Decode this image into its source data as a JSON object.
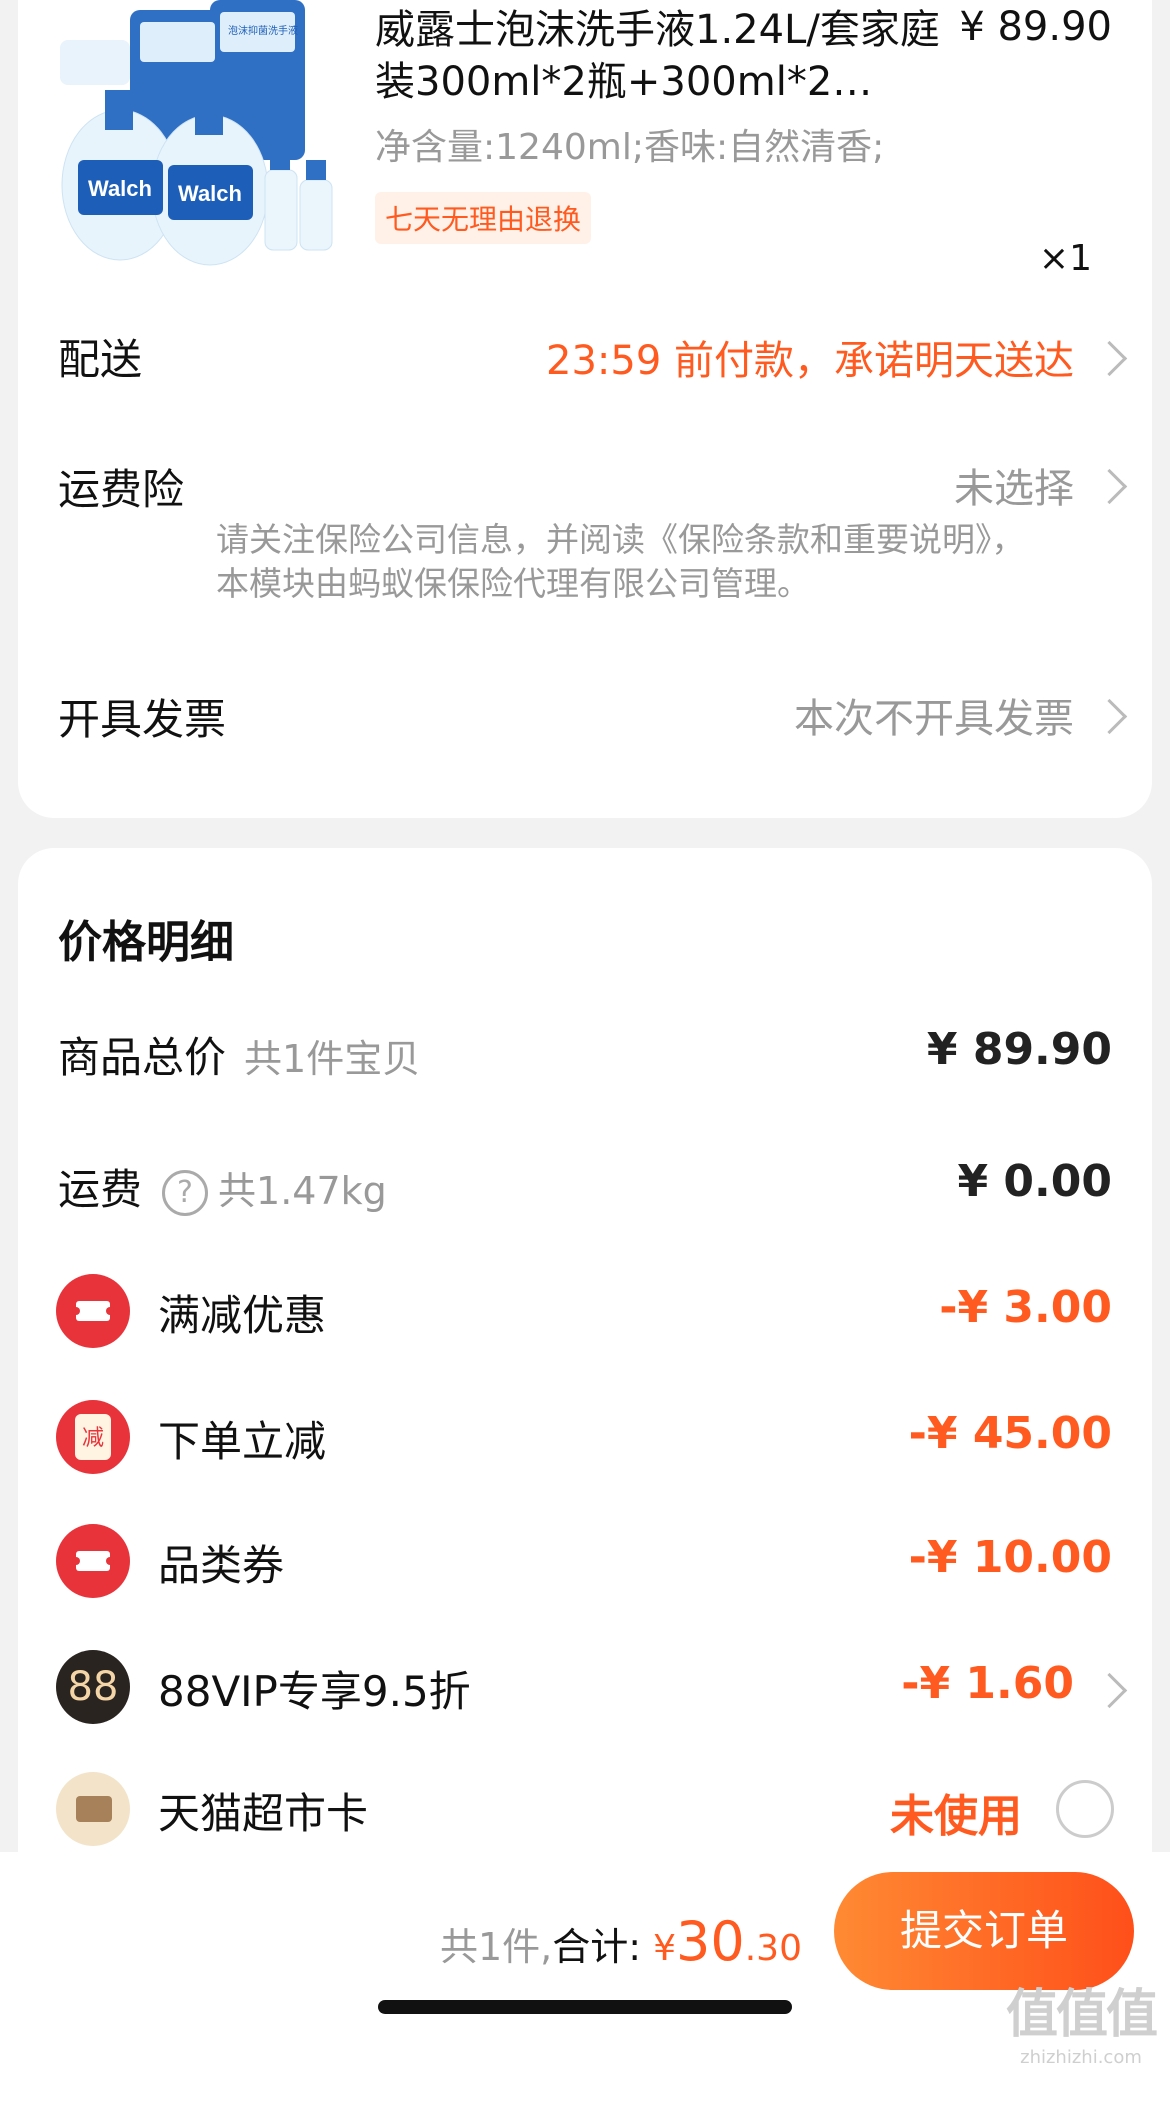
{
  "product": {
    "title": "威露士泡沫洗手液1.24L/套家庭装300ml*2瓶+300ml*2…",
    "price": "¥ 89.90",
    "spec": "净含量:1240ml;香味:自然清香;",
    "tag": "七天无理由退换",
    "qty": "×1",
    "brand_text": "Walch",
    "pack_text": "泡沫抑菌洗手液"
  },
  "delivery": {
    "label": "配送",
    "value": "23:59 前付款，承诺明天送达"
  },
  "insurance": {
    "label": "运费险",
    "value": "未选择",
    "note": "请关注保险公司信息，并阅读《保险条款和重要说明》，本模块由蚂蚁保保险代理有限公司管理。"
  },
  "invoice": {
    "label": "开具发票",
    "value": "本次不开具发票"
  },
  "price_detail": {
    "title": "价格明细",
    "goods_total": {
      "label": "商品总价",
      "sub": "共1件宝贝",
      "value": "¥ 89.90"
    },
    "shipping": {
      "label": "运费",
      "sub": "共1.47kg",
      "value": "¥ 0.00"
    },
    "discounts": [
      {
        "label": "满减优惠",
        "value": "-¥ 3.00",
        "icon": "ticket-icon"
      },
      {
        "label": "下单立减",
        "value": "-¥ 45.00",
        "icon": "redbag-icon",
        "icon_text": "减"
      },
      {
        "label": "品类券",
        "value": "-¥ 10.00",
        "icon": "ticket-icon"
      },
      {
        "label": "88VIP专享9.5折",
        "value": "-¥ 1.60",
        "icon": "vip-icon",
        "icon_text": "88"
      }
    ],
    "supermarket_card": {
      "label": "天猫超市卡",
      "value": "未使用"
    }
  },
  "footer": {
    "count": "共1件,",
    "total_label": "合计:",
    "currency": "¥",
    "total_int": "30",
    "total_dec": ".30",
    "submit": "提交订单"
  },
  "watermark": {
    "big": "值值值",
    "small": "zhizhizhi.com"
  },
  "colors": {
    "accent": "#ff5a1f",
    "red_icon": "#e8333b",
    "vip_bg": "#2a2421"
  }
}
